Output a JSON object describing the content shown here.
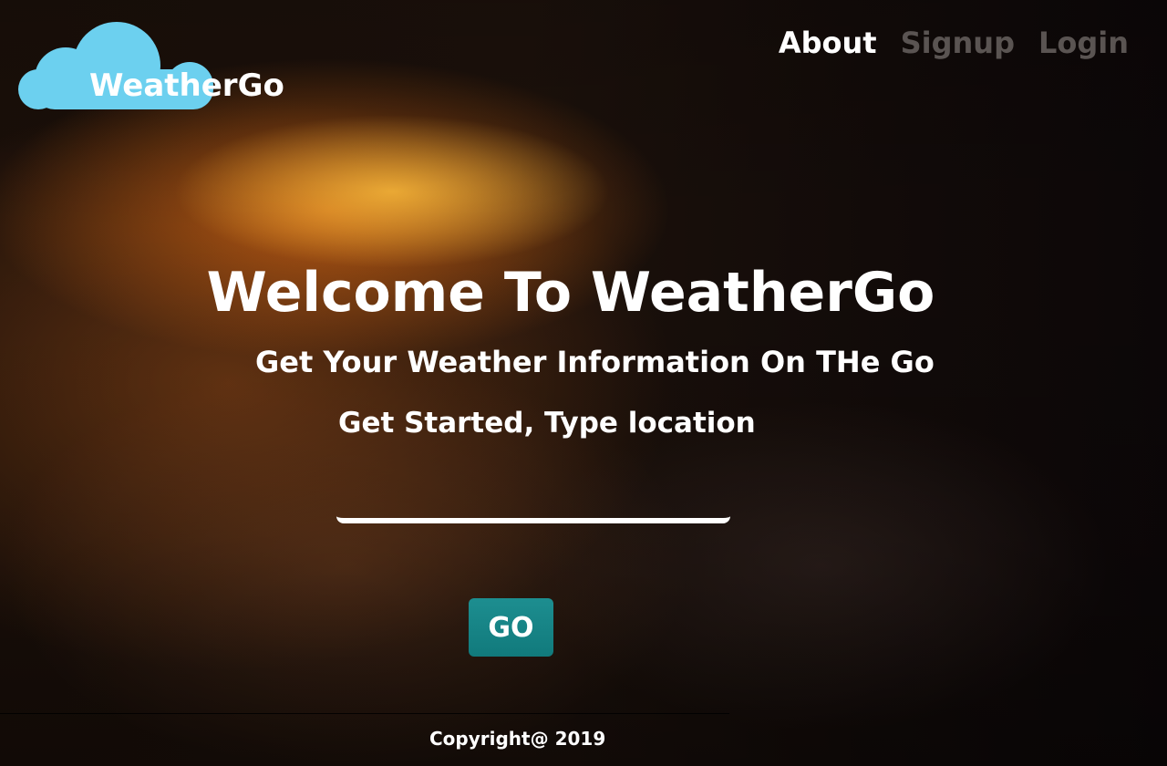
{
  "brand": {
    "name": "WeatherGo",
    "logo_icon": "cloud-icon",
    "logo_color": "#6cd0ef"
  },
  "nav": {
    "items": [
      {
        "label": "About",
        "state": "active"
      },
      {
        "label": "Signup",
        "state": "inactive"
      },
      {
        "label": "Login",
        "state": "inactive"
      }
    ]
  },
  "hero": {
    "title": "Welcome To WeatherGo",
    "subtitle": "Get Your Weather Information On THe Go",
    "cta_text": "Get Started, Type location",
    "location_input": {
      "value": "",
      "placeholder": ""
    },
    "go_button_label": "GO",
    "go_button_color": "#178587"
  },
  "footer": {
    "copyright": "Copyright@ 2019"
  }
}
